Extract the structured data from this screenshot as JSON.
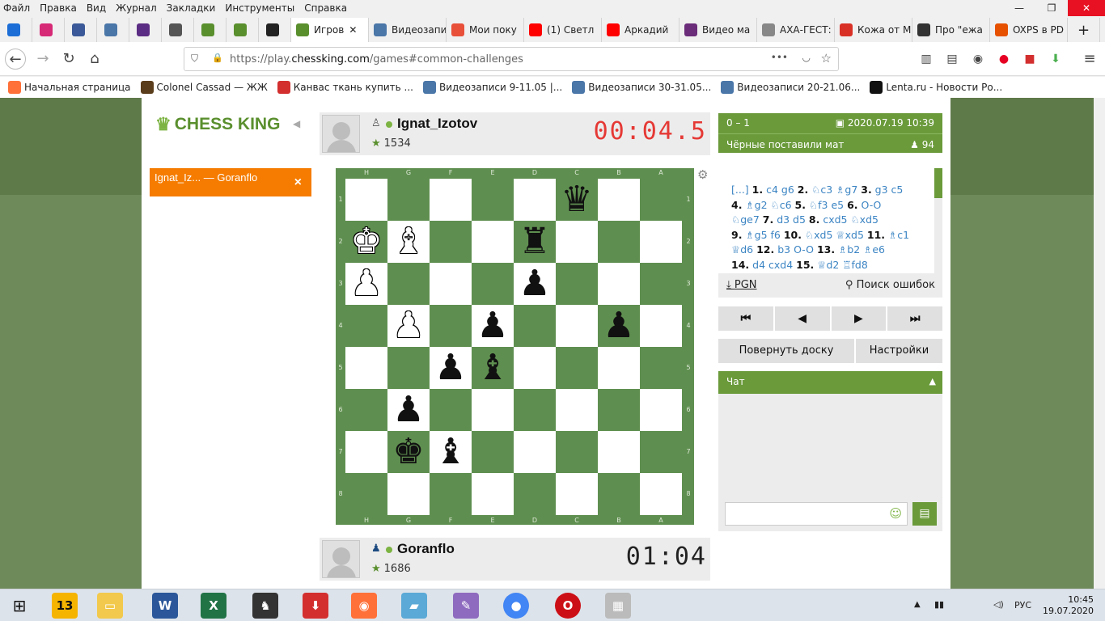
{
  "menu": [
    "Файл",
    "Правка",
    "Вид",
    "Журнал",
    "Закладки",
    "Инструменты",
    "Справка"
  ],
  "tabs": [
    {
      "label": "",
      "color": "#1c6ed6",
      "icon": "mail-icon"
    },
    {
      "label": "",
      "color": "#d62976",
      "icon": "instagram-icon"
    },
    {
      "label": "",
      "color": "#3b5998",
      "icon": "facebook-icon"
    },
    {
      "label": "",
      "color": "#4a76a8",
      "icon": "vk-icon"
    },
    {
      "label": "",
      "color": "#5b2c83",
      "icon": "app-icon"
    },
    {
      "label": "",
      "color": "#555555",
      "icon": "browser-icon"
    },
    {
      "label": "",
      "color": "#5a8f2e",
      "icon": "chess-pawn-icon"
    },
    {
      "label": "",
      "color": "#5a8f2e",
      "icon": "chess-crown-icon"
    },
    {
      "label": "",
      "color": "#222222",
      "icon": "b-icon"
    },
    {
      "label": "Игров",
      "color": "#5a8f2e",
      "icon": "chess-crown-icon",
      "active": true
    },
    {
      "label": "Видеозапи",
      "color": "#4a76a8",
      "icon": "vk-icon"
    },
    {
      "label": "Мои поку",
      "color": "#e8503a",
      "icon": "shop-icon"
    },
    {
      "label": "(1) Светл",
      "color": "#ff0000",
      "icon": "youtube-icon"
    },
    {
      "label": "Аркадий",
      "color": "#ff0000",
      "icon": "youtube-icon"
    },
    {
      "label": "Видео ма",
      "color": "#6b2c7a",
      "icon": "video-icon"
    },
    {
      "label": "АХА-ГЕСТ: Го",
      "color": "#888888",
      "icon": "page-icon"
    },
    {
      "label": "Кожа от М",
      "color": "#d93025",
      "icon": "leather-icon"
    },
    {
      "label": "Про \"ежа",
      "color": "#333333",
      "icon": "github-icon"
    },
    {
      "label": "OXPS в PD",
      "color": "#e65100",
      "icon": "pdf-icon"
    }
  ],
  "url": {
    "prefix": "https://play.",
    "domain": "chessking.com",
    "path": "/games#common-challenges"
  },
  "bookmarks": [
    "Начальная страница",
    "Colonel Cassad — ЖЖ",
    "Канвас ткань купить ...",
    "Видеозаписи 9-11.05 |...",
    "Видеозаписи 30-31.05...",
    "Видеозаписи 20-21.06...",
    "Lenta.ru - Новости Ро..."
  ],
  "logo": "CHESS KING",
  "game_tab": {
    "white": "Ignat_Iz...",
    "sep": "—",
    "black": "Goranflo"
  },
  "top_player": {
    "name": "Ignat_Izotov",
    "rating": "1534",
    "clock": "00:04.5",
    "clock_color": "#e53935"
  },
  "bottom_player": {
    "name": "Goranflo",
    "rating": "1686",
    "clock": "01:04",
    "clock_color": "#222222"
  },
  "board": {
    "files": [
      "H",
      "G",
      "F",
      "E",
      "D",
      "C",
      "B",
      "A"
    ],
    "ranks": [
      "1",
      "2",
      "3",
      "4",
      "5",
      "6",
      "7",
      "8"
    ],
    "pieces": [
      {
        "sq": "C1",
        "glyph": "♛",
        "color": "black"
      },
      {
        "sq": "H2",
        "glyph": "♚",
        "color": "white"
      },
      {
        "sq": "G2",
        "glyph": "♝",
        "color": "white"
      },
      {
        "sq": "D2",
        "glyph": "♜",
        "color": "black"
      },
      {
        "sq": "H3",
        "glyph": "♟",
        "color": "white"
      },
      {
        "sq": "D3",
        "glyph": "♟",
        "color": "black"
      },
      {
        "sq": "G4",
        "glyph": "♟",
        "color": "white"
      },
      {
        "sq": "E4",
        "glyph": "♟",
        "color": "black"
      },
      {
        "sq": "B4",
        "glyph": "♟",
        "color": "black"
      },
      {
        "sq": "F5",
        "glyph": "♟",
        "color": "black"
      },
      {
        "sq": "E5",
        "glyph": "♝",
        "color": "black"
      },
      {
        "sq": "G6",
        "glyph": "♟",
        "color": "black"
      },
      {
        "sq": "G7",
        "glyph": "♚",
        "color": "black"
      },
      {
        "sq": "F7",
        "glyph": "♝",
        "color": "black"
      }
    ]
  },
  "result": {
    "score": "0 – 1",
    "date": "2020.07.19 10:39",
    "status": "Чёрные поставили мат",
    "viewers": "94"
  },
  "moves_html": "[...] <b>1.</b> c4 g6 <b>2.</b> ♘c3 ♗g7 <b>3.</b> g3 c5<br><b>4.</b> ♗g2 ♘c6 <b>5.</b> ♘f3 e5 <b>6.</b> O-O<br>♘ge7 <b>7.</b> d3 d5 <b>8.</b> cxd5 ♘xd5<br><b>9.</b> ♗g5 f6 <b>10.</b> ♘xd5 ♕xd5 <b>11.</b> ♗c1<br>♕d6 <b>12.</b> b3 O-O <b>13.</b> ♗b2 ♗e6<br><b>14.</b> d4 cxd4 <b>15.</b> ♕d2 ♖fd8",
  "tools": {
    "pgn": "PGN",
    "errors": "Поиск ошибок"
  },
  "nav": [
    "⏮",
    "◀",
    "▶",
    "⏭"
  ],
  "options": {
    "flip": "Повернуть доску",
    "settings": "Настройки"
  },
  "chat": {
    "title": "Чат",
    "arrow": "▲",
    "placeholder": ""
  },
  "taskbar": {
    "lang": "РУС",
    "time": "10:45",
    "date": "19.07.2020"
  }
}
